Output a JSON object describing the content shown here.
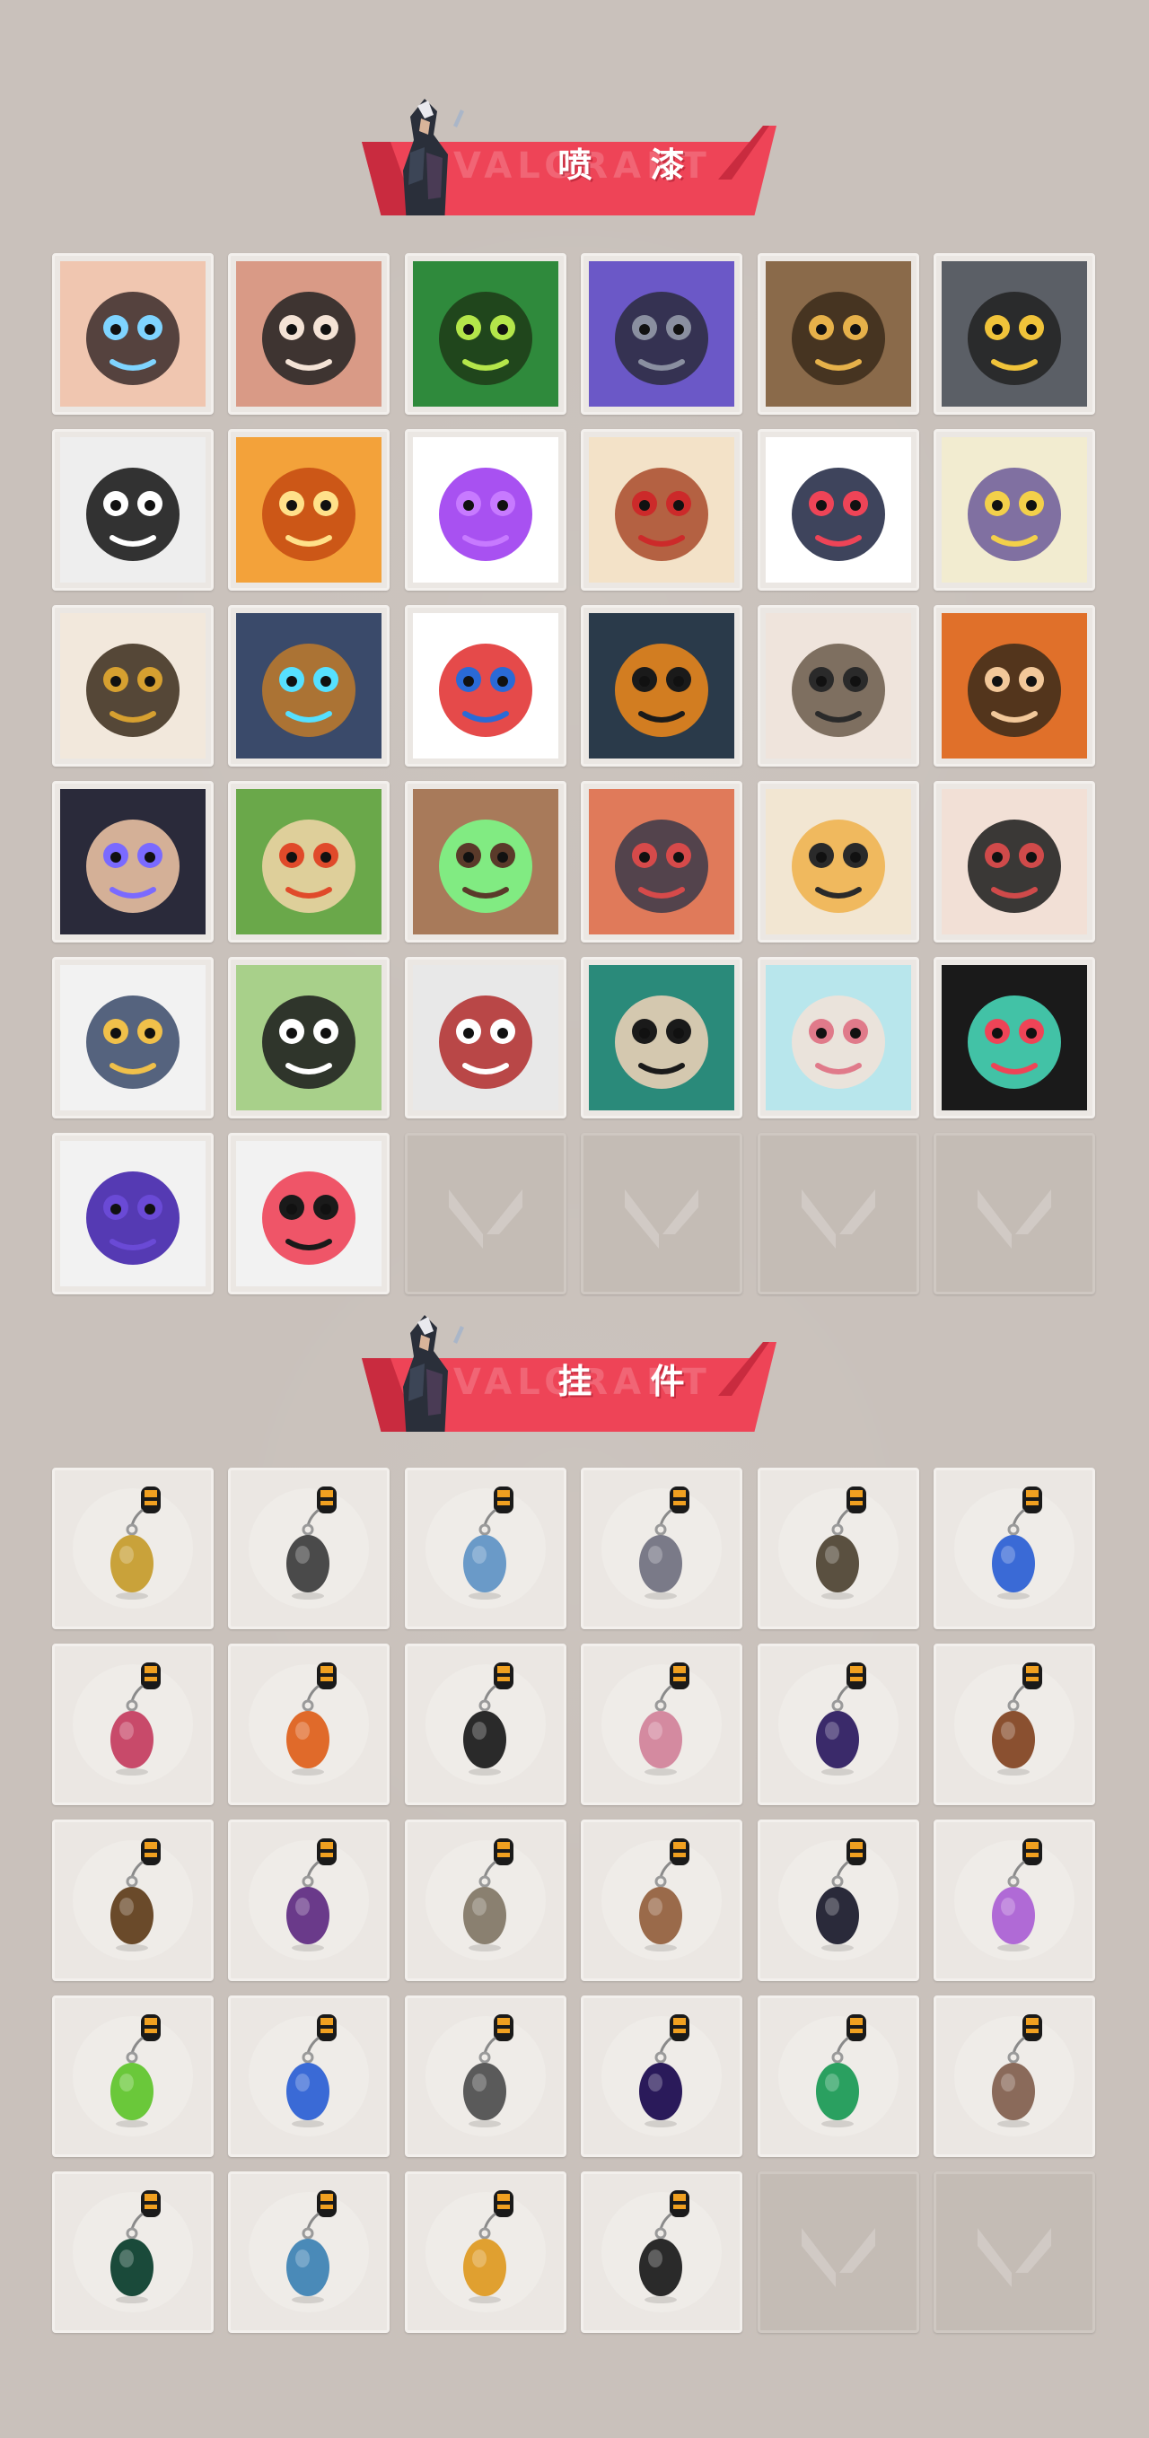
{
  "sections": {
    "sprays": {
      "title": "喷 漆",
      "watermark": "VALORANT",
      "items": [
        {
          "icon": "spray-face-butterfly-icon"
        },
        {
          "icon": "spray-angry-face-icon"
        },
        {
          "icon": "spray-green-mask-icon"
        },
        {
          "icon": "spray-purple-gun-icon"
        },
        {
          "icon": "spray-penguin-beanie-icon"
        },
        {
          "icon": "spray-robot-eye-icon"
        },
        {
          "icon": "spray-star-badge-icon"
        },
        {
          "icon": "spray-orange-tiger-mask-icon"
        },
        {
          "icon": "spray-purple-graffiti-icon"
        },
        {
          "icon": "spray-old-man-goggles-icon"
        },
        {
          "icon": "spray-chevron-logo-icon"
        },
        {
          "icon": "spray-sleeping-cat-icon"
        },
        {
          "icon": "spray-pixel-agent-icon"
        },
        {
          "icon": "spray-armored-agent-icon"
        },
        {
          "icon": "spray-clown-icon"
        },
        {
          "icon": "spray-orange-hat-icon"
        },
        {
          "icon": "spray-raccoon-icon"
        },
        {
          "icon": "spray-bearded-man-icon"
        },
        {
          "icon": "spray-anime-boy-icon"
        },
        {
          "icon": "spray-green-box-icon"
        },
        {
          "icon": "spray-glowing-eyes-icon"
        },
        {
          "icon": "spray-crying-mole-icon"
        },
        {
          "icon": "spray-tiger-icon"
        },
        {
          "icon": "spray-girl-pencil-icon"
        },
        {
          "icon": "spray-penguin-icon"
        },
        {
          "icon": "spray-frog-hat-icon"
        },
        {
          "icon": "spray-x-button-icon"
        },
        {
          "icon": "spray-goggles-girl-icon"
        },
        {
          "icon": "spray-blue-hair-girl-icon"
        },
        {
          "icon": "spray-valorant-logo-icon"
        },
        {
          "icon": "spray-purple-tag-icon"
        },
        {
          "icon": "spray-red-valorant-icon"
        },
        {
          "icon": "empty-slot-icon",
          "empty": true
        },
        {
          "icon": "empty-slot-icon",
          "empty": true
        },
        {
          "icon": "empty-slot-icon",
          "empty": true
        },
        {
          "icon": "empty-slot-icon",
          "empty": true
        }
      ]
    },
    "buddies": {
      "title": "挂 件",
      "watermark": "VALORANT",
      "items": [
        {
          "icon": "buddy-gold-cat-icon"
        },
        {
          "icon": "buddy-drone-icon"
        },
        {
          "icon": "buddy-bread-box-icon"
        },
        {
          "icon": "buddy-raccoon-astronaut-icon"
        },
        {
          "icon": "buddy-pouch-icon"
        },
        {
          "icon": "buddy-blue-bottle-icon"
        },
        {
          "icon": "buddy-sword-icon"
        },
        {
          "icon": "buddy-chili-icon"
        },
        {
          "icon": "buddy-braid-icon"
        },
        {
          "icon": "buddy-cupcake-icon"
        },
        {
          "icon": "buddy-ep9-badge-icon"
        },
        {
          "icon": "buddy-teddy-bear-icon"
        },
        {
          "icon": "buddy-turret-icon"
        },
        {
          "icon": "buddy-agent-figure-icon"
        },
        {
          "icon": "buddy-cowboy-icon"
        },
        {
          "icon": "buddy-crate-icon"
        },
        {
          "icon": "buddy-tassel-cat-icon"
        },
        {
          "icon": "buddy-lava-lamp-icon"
        },
        {
          "icon": "buddy-green-pager-icon"
        },
        {
          "icon": "buddy-astronaut-icon"
        },
        {
          "icon": "buddy-radio-icon"
        },
        {
          "icon": "buddy-ep9-token-icon"
        },
        {
          "icon": "buddy-green-can-icon"
        },
        {
          "icon": "buddy-fox-icon"
        },
        {
          "icon": "buddy-ep8-token-icon"
        },
        {
          "icon": "buddy-ufo-icon"
        },
        {
          "icon": "buddy-bee-icon"
        },
        {
          "icon": "buddy-v-token-icon"
        },
        {
          "icon": "empty-slot-icon",
          "empty": true
        },
        {
          "icon": "empty-slot-icon",
          "empty": true
        }
      ]
    }
  },
  "colors": {
    "background": "#c9c1bb",
    "accent": "#ee4457",
    "accent_dark": "#c92b3f",
    "tile": "#ebe7e3",
    "tile_empty": "#c4bcb5"
  }
}
